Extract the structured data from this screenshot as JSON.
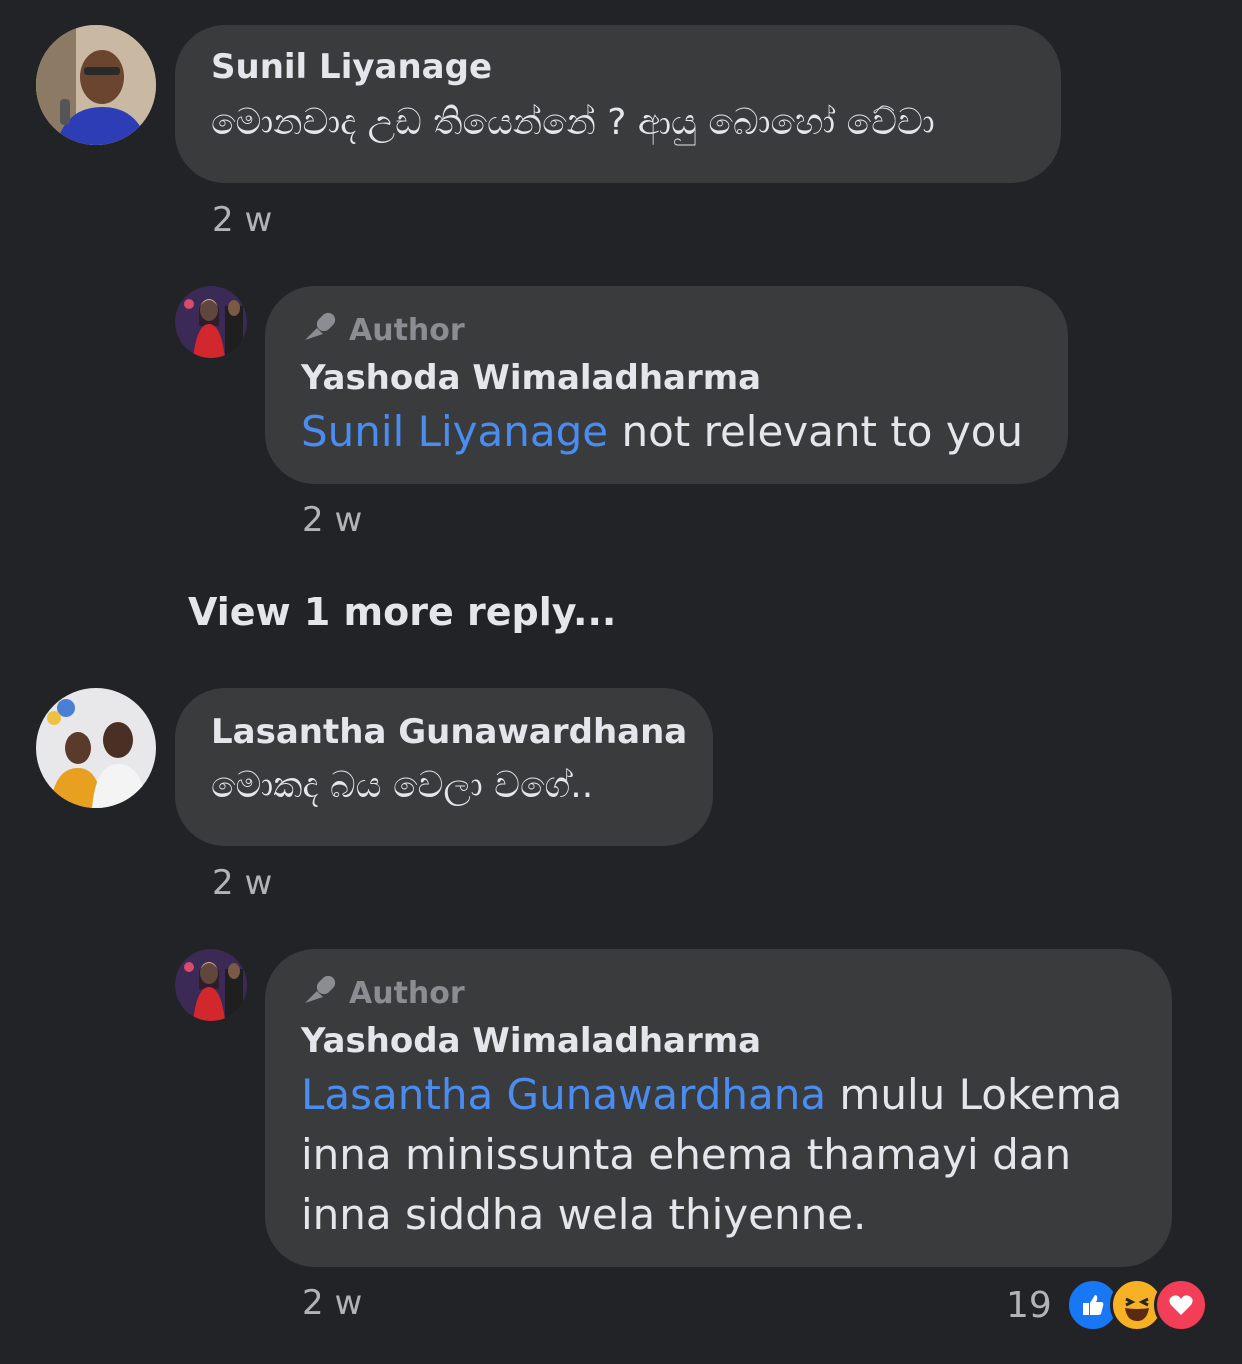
{
  "comments": [
    {
      "author": "Sunil Liyanage",
      "text": "මොනවාද උඩ තියෙන්නේ ? ආයු බොහෝ වේවා",
      "time": "2 w",
      "reply": {
        "badge": "Author",
        "author": "Yashoda Wimaladharma",
        "mention": "Sunil Liyanage",
        "text": " not relevant to you",
        "time": "2 w"
      }
    },
    {
      "author": "Lasantha Gunawardhana",
      "text": "මොකද බය වෙලා වගේ..",
      "time": "2 w",
      "reply": {
        "badge": "Author",
        "author": "Yashoda Wimaladharma",
        "mention": "Lasantha Gunawardhana",
        "text": " mulu Lokema inna minissunta ehema thamayi dan inna siddha wela thiyenne.",
        "time": "2 w",
        "reaction_count": "19",
        "reactions": [
          "like-icon",
          "haha-icon",
          "love-icon"
        ]
      }
    }
  ],
  "view_more": "View 1 more reply...",
  "colors": {
    "background": "#222326",
    "bubble": "#3a3b3c",
    "mention": "#4a8cf0",
    "like": "#1877f2",
    "love": "#f33e58",
    "haha": "#f7b125"
  }
}
